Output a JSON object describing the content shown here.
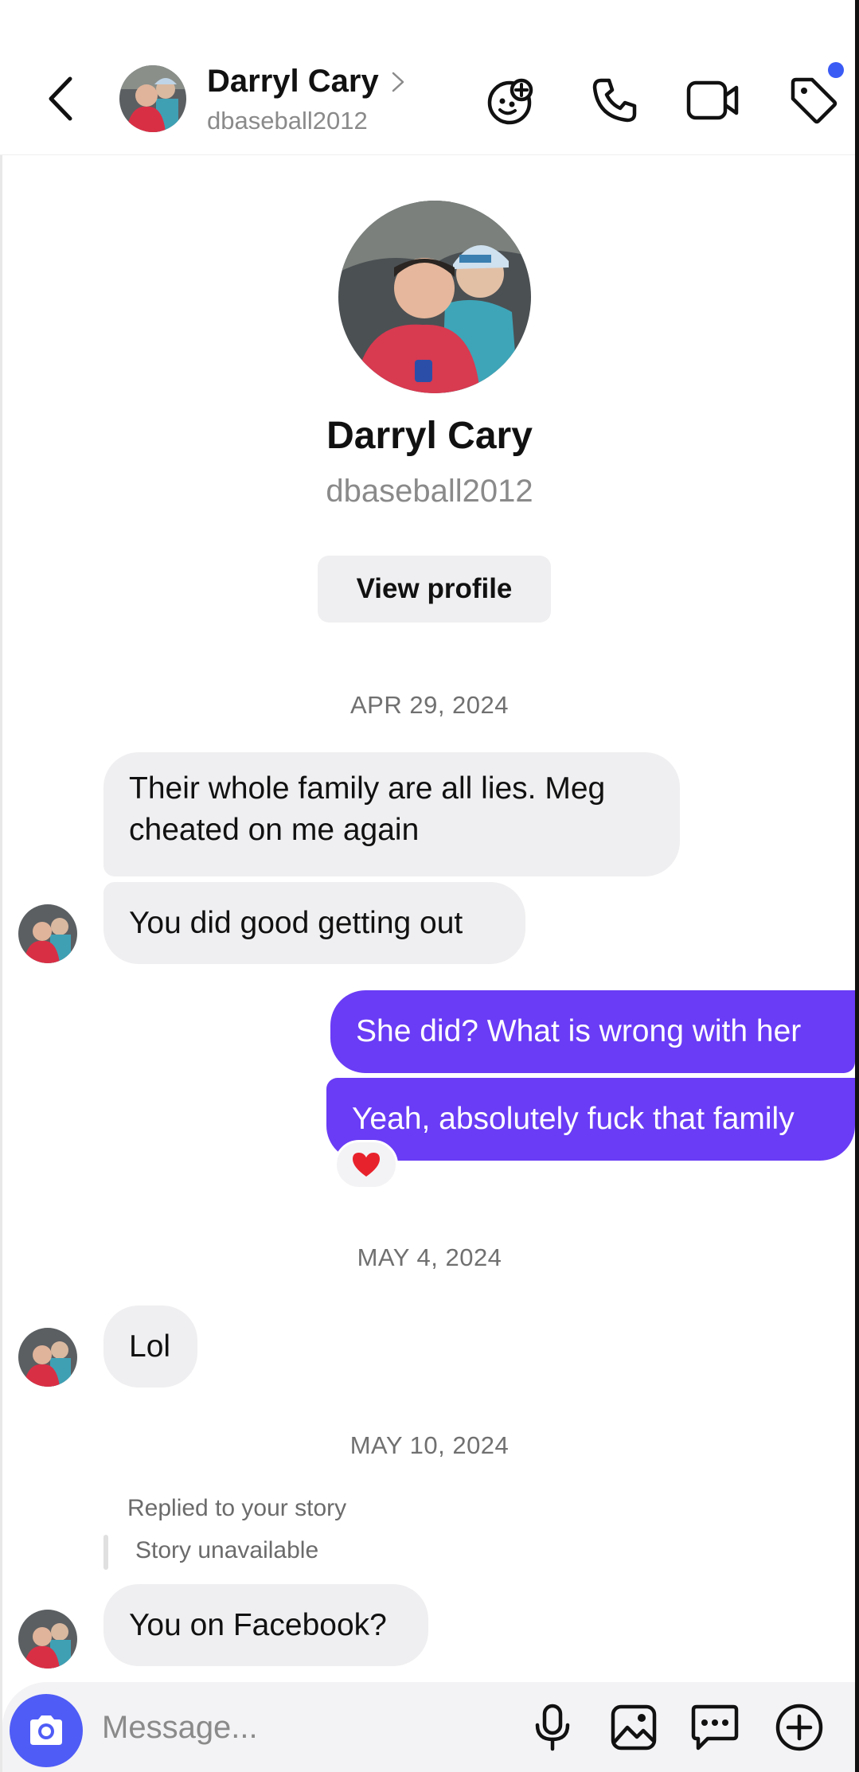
{
  "header": {
    "name": "Darryl Cary",
    "handle": "dbaseball2012",
    "icons": [
      "back-chevron-icon",
      "ai-sparkle-icon",
      "phone-icon",
      "video-camera-icon",
      "tag-icon"
    ],
    "accent": "#3b5bf5"
  },
  "profile": {
    "name": "Darryl Cary",
    "handle": "dbaseball2012",
    "view_profile_label": "View profile"
  },
  "thread": {
    "date_1": "APR 29, 2024",
    "msg_in_1": "Their whole family are all lies. Meg cheated on me again",
    "msg_in_2": "You did good getting out",
    "msg_out_1": "She did? What is wrong with her",
    "msg_out_2": "Yeah, absolutely fuck that family",
    "reaction": "❤️",
    "date_2": "MAY 4, 2024",
    "msg_in_3": "Lol",
    "date_3": "MAY 10, 2024",
    "reply_label": "Replied to your story",
    "reply_story": "Story unavailable",
    "msg_in_4": "You on Facebook?"
  },
  "composer": {
    "placeholder": "Message...",
    "icons": [
      "camera-icon",
      "microphone-icon",
      "image-icon",
      "sticker-chat-icon",
      "add-icon"
    ]
  },
  "colors": {
    "outgoing_bubble": "#6a3cf5",
    "incoming_bubble": "#efeff1",
    "camera_button": "#4f5cf6"
  }
}
